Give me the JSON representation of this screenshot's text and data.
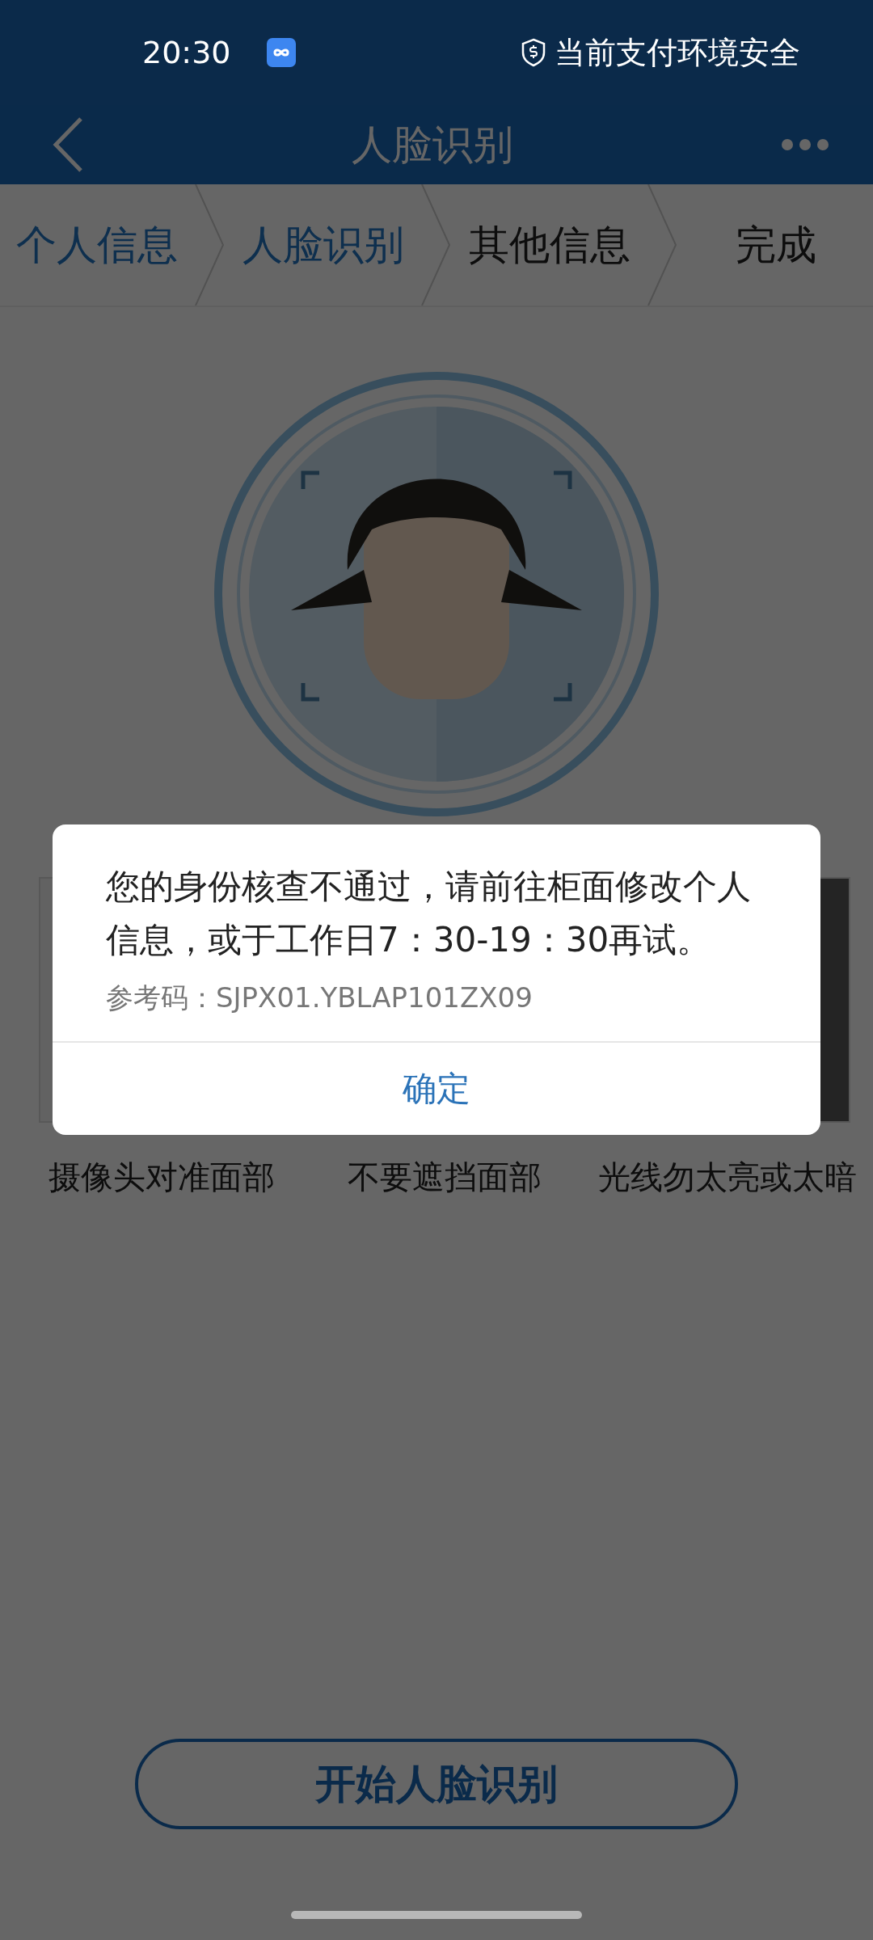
{
  "status_bar": {
    "time": "20:30",
    "security_text": "当前支付环境安全"
  },
  "nav": {
    "title": "人脸识别"
  },
  "steps": [
    {
      "label": "个人信息",
      "reached": true
    },
    {
      "label": "人脸识别",
      "reached": true
    },
    {
      "label": "其他信息",
      "reached": false
    },
    {
      "label": "完成",
      "reached": false
    }
  ],
  "tips": [
    {
      "kind": "picture",
      "label": "摄像头对准面部"
    },
    {
      "label": "不要遮挡面部"
    },
    {
      "kind": "picture",
      "label": "光线勿太亮或太暗"
    }
  ],
  "primary_button": "开始人脸识别",
  "dialog": {
    "message": "您的身份核查不通过，请前往柜面修改个人信息，或于工作日7：30-19：30再试。",
    "reference": "参考码：SJPX01.YBLAP101ZX09",
    "confirm": "确定"
  }
}
